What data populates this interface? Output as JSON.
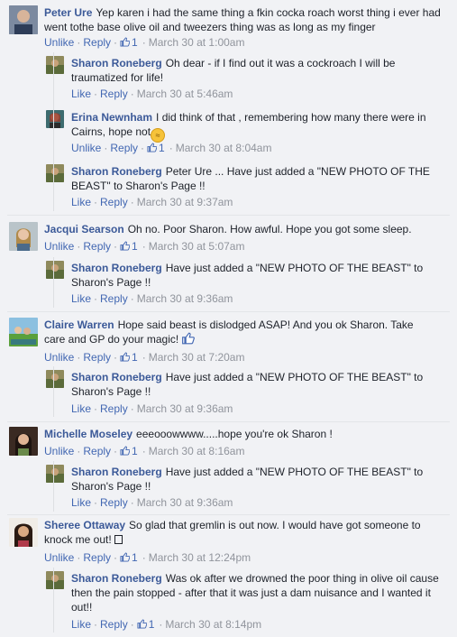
{
  "comments": [
    {
      "author": "Peter Ure",
      "text": "Yep karen i had the same thing a fkin cocka roach worst thing i ever had went tothe base olive oil and tweezers thing was as long as my finger",
      "actions": {
        "unlike": "Unlike",
        "reply": "Reply",
        "likes": "1",
        "time": "March 30 at 1:00am"
      },
      "replies": [
        {
          "author": "Sharon Roneberg",
          "text": "Oh dear - if I find out it was a cockroach I will be traumatized for life!",
          "actions": {
            "like": "Like",
            "reply": "Reply",
            "time": "March 30 at 5:46am"
          }
        },
        {
          "author": "Erina Newnham",
          "text": "I did think of that , remembering how many there were in Cairns, hope not",
          "actions": {
            "unlike": "Unlike",
            "reply": "Reply",
            "likes": "1",
            "time": "March 30 at 8:04am"
          }
        },
        {
          "author": "Sharon Roneberg",
          "text": "Peter Ure ... Have just added a \"NEW PHOTO OF THE BEAST\" to Sharon's Page !!",
          "actions": {
            "like": "Like",
            "reply": "Reply",
            "time": "March 30 at 9:37am"
          }
        }
      ]
    },
    {
      "author": "Jacqui Searson",
      "text": "Oh no. Poor Sharon. How awful. Hope you got some sleep.",
      "actions": {
        "unlike": "Unlike",
        "reply": "Reply",
        "likes": "1",
        "time": "March 30 at 5:07am"
      },
      "replies": [
        {
          "author": "Sharon Roneberg",
          "text": "Have just added a \"NEW PHOTO OF THE BEAST\" to Sharon's Page !!",
          "actions": {
            "like": "Like",
            "reply": "Reply",
            "time": "March 30 at 9:36am"
          }
        }
      ]
    },
    {
      "author": "Claire Warren",
      "text": "Hope said beast is dislodged ASAP! And you ok Sharon. Take care and GP do your magic!",
      "actions": {
        "unlike": "Unlike",
        "reply": "Reply",
        "likes": "1",
        "time": "March 30 at 7:20am"
      },
      "replies": [
        {
          "author": "Sharon Roneberg",
          "text": "Have just added a \"NEW PHOTO OF THE BEAST\" to Sharon's Page !!",
          "actions": {
            "like": "Like",
            "reply": "Reply",
            "time": "March 30 at 9:36am"
          }
        }
      ]
    },
    {
      "author": "Michelle Moseley",
      "text": "eeeooowwww.....hope you're ok Sharon !",
      "actions": {
        "unlike": "Unlike",
        "reply": "Reply",
        "likes": "1",
        "time": "March 30 at 8:16am"
      },
      "replies": [
        {
          "author": "Sharon Roneberg",
          "text": "Have just added a \"NEW PHOTO OF THE BEAST\" to Sharon's Page !!",
          "actions": {
            "like": "Like",
            "reply": "Reply",
            "time": "March 30 at 9:36am"
          }
        }
      ]
    },
    {
      "author": "Sheree Ottaway",
      "text": "So glad that gremlin is out now. I would have got someone to knock me out!",
      "actions": {
        "unlike": "Unlike",
        "reply": "Reply",
        "likes": "1",
        "time": "March 30 at 12:24pm"
      },
      "replies": [
        {
          "author": "Sharon Roneberg",
          "text": "Was ok after we drowned the poor thing in olive oil cause then the pain stopped - after that it was just a dam nuisance and I wanted it out!!",
          "actions": {
            "like": "Like",
            "reply": "Reply",
            "likes": "1",
            "time": "March 30 at 8:14pm"
          }
        }
      ]
    }
  ],
  "colors": {
    "author": "#3b5998",
    "link": "#4267b2",
    "meta": "#90949c",
    "background": "#f1f2f5"
  },
  "icons": {
    "like": "thumbs-up-icon",
    "emoji": "confused-face-emoji",
    "like_emoji": "thumbs-up-emoji"
  }
}
